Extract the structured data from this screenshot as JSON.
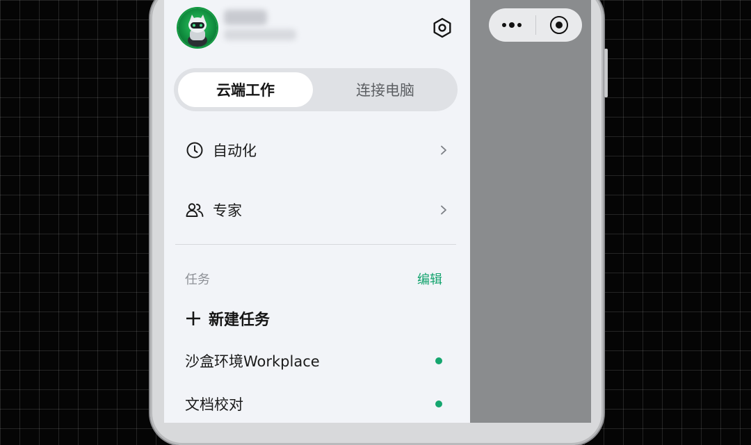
{
  "drawer": {
    "mode_tabs": [
      {
        "label": "云端工作",
        "active": true
      },
      {
        "label": "连接电脑",
        "active": false
      }
    ],
    "menu": [
      {
        "label": "自动化",
        "icon": "clock-icon"
      },
      {
        "label": "专家",
        "icon": "users-icon"
      }
    ],
    "tasks_section": {
      "title": "任务",
      "edit_label": "编辑",
      "new_task_label": "新建任务",
      "items": [
        {
          "label": "沙盒环境Workplace",
          "status_color": "#15a66f"
        },
        {
          "label": "文档校对",
          "status_color": "#15a66f"
        }
      ]
    }
  },
  "capsule": {
    "more_icon": "more-dots-icon",
    "close_icon": "record-circle-icon"
  },
  "colors": {
    "accent": "#14a36e",
    "status_dot": "#15a66f",
    "drawer_bg": "#f2f4f8"
  }
}
